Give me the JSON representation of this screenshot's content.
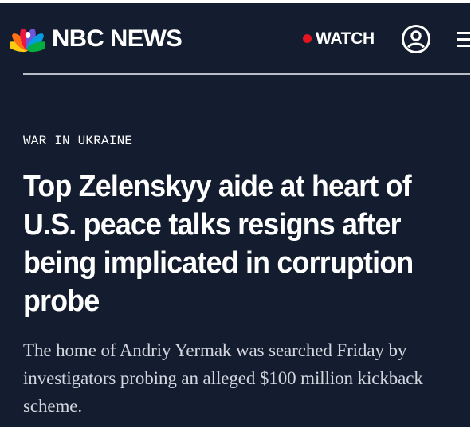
{
  "header": {
    "brand": "NBC NEWS",
    "watch_label": "WATCH",
    "icons": {
      "peacock": "nbc-peacock-logo",
      "live_dot": "live-dot-icon",
      "account": "account-icon",
      "menu": "hamburger-menu-icon"
    },
    "colors": {
      "background": "#141d2f",
      "live": "#e5141e",
      "divider": "#b8bdc6"
    }
  },
  "article": {
    "kicker": "WAR IN UKRAINE",
    "headline": "Top Zelenskyy aide at heart of U.S. peace talks resigns after being implicated in corruption probe",
    "dek": "The home of Andriy Yermak was searched Friday by investigators probing an alleged $100 million kickback scheme."
  }
}
